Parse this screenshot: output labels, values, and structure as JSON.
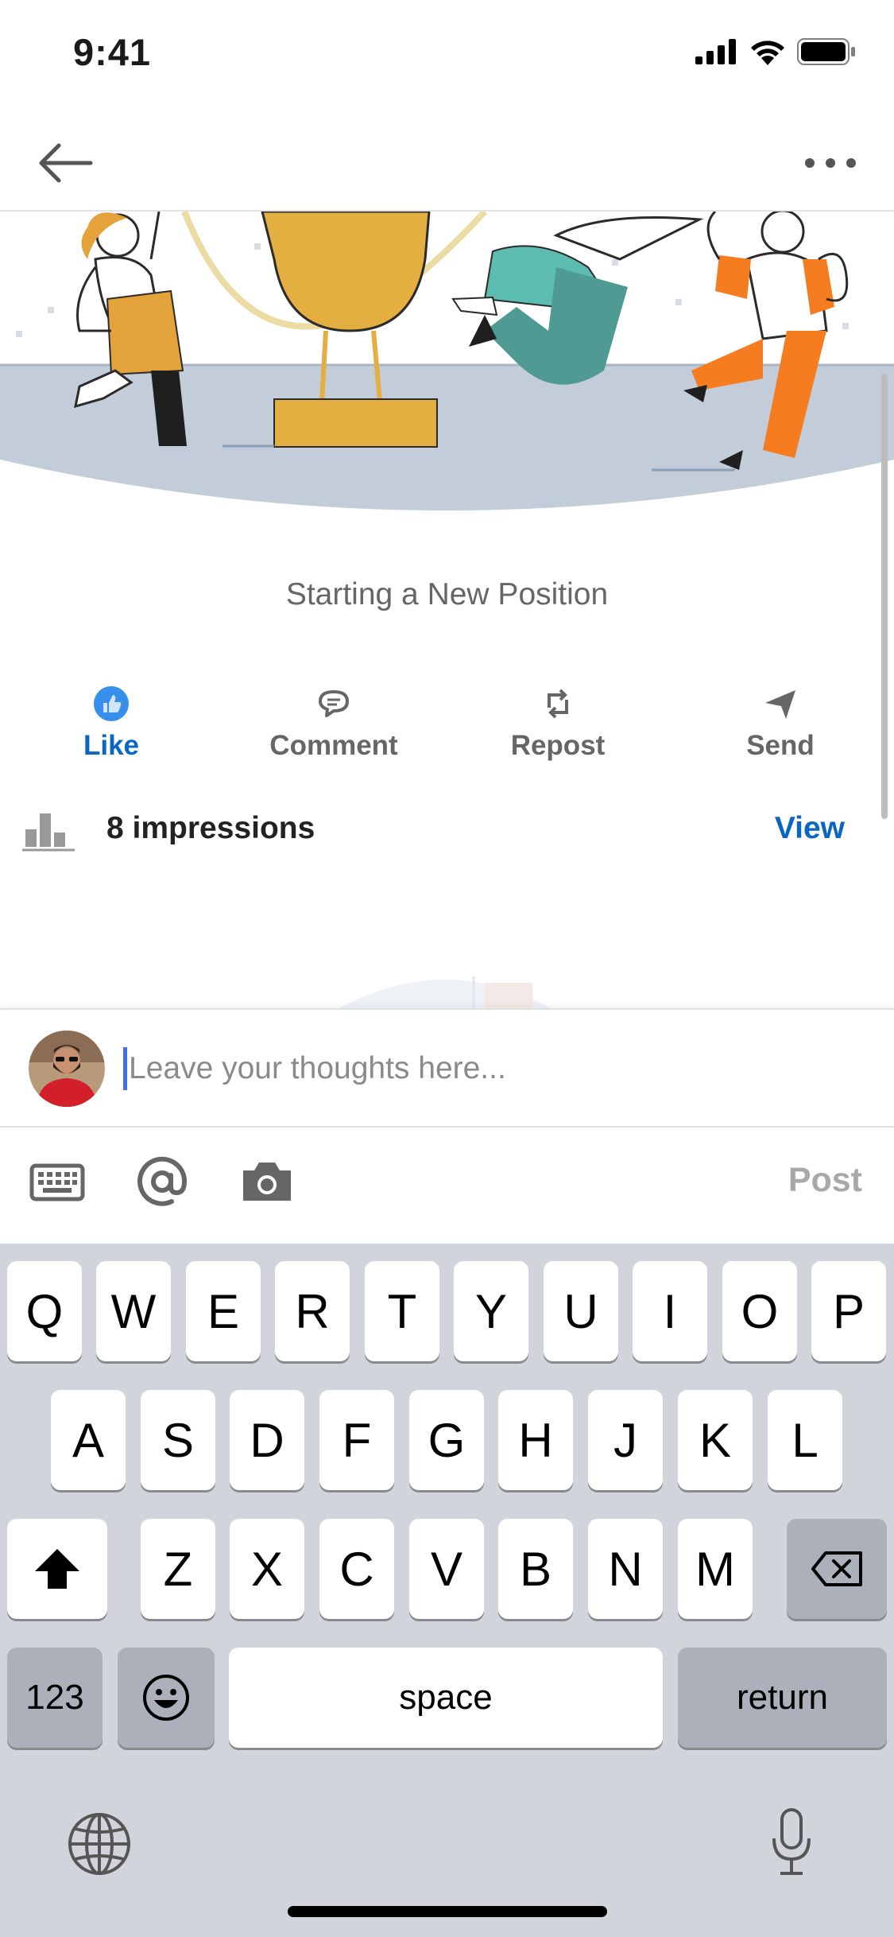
{
  "status": {
    "time": "9:41"
  },
  "post": {
    "title": "Starting a New Position"
  },
  "actions": [
    {
      "label": "Like",
      "active": true
    },
    {
      "label": "Comment"
    },
    {
      "label": "Repost"
    },
    {
      "label": "Send"
    }
  ],
  "impressions": {
    "text": "8 impressions",
    "view_label": "View"
  },
  "composer": {
    "placeholder": "Leave your thoughts here...",
    "value": ""
  },
  "toolbar": {
    "post_label": "Post"
  },
  "keyboard": {
    "row1": [
      "Q",
      "W",
      "E",
      "R",
      "T",
      "Y",
      "U",
      "I",
      "O",
      "P"
    ],
    "row2": [
      "A",
      "S",
      "D",
      "F",
      "G",
      "H",
      "J",
      "K",
      "L"
    ],
    "row3": [
      "Z",
      "X",
      "C",
      "V",
      "B",
      "N",
      "M"
    ],
    "numbers_label": "123",
    "space_label": "space",
    "return_label": "return"
  },
  "colors": {
    "accent": "#0a66c2",
    "keyboard_bg": "#d1d4db"
  }
}
